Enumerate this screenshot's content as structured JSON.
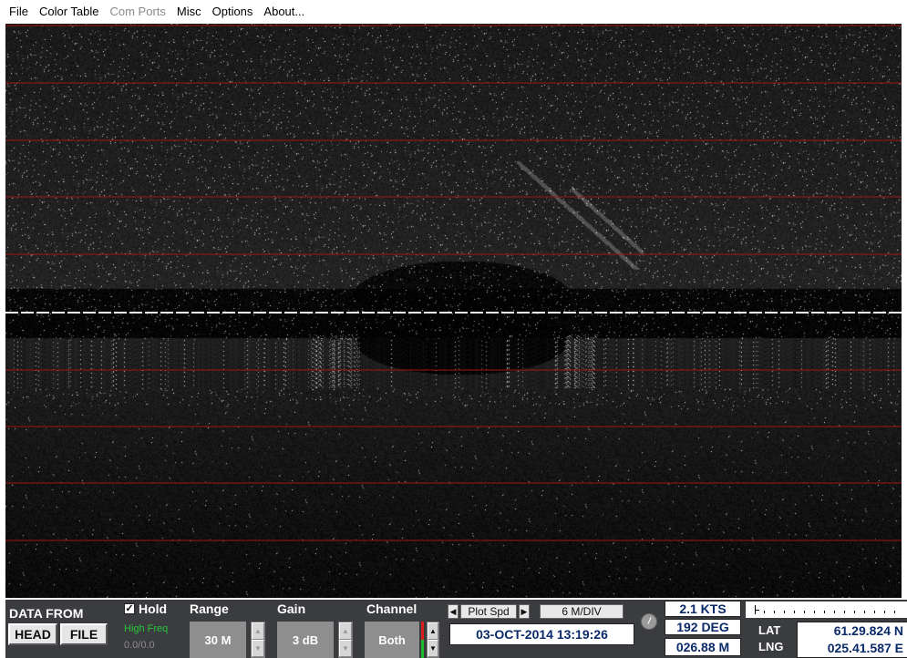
{
  "menu": {
    "items": [
      {
        "label": "File",
        "enabled": true
      },
      {
        "label": "Color Table",
        "enabled": true
      },
      {
        "label": "Com Ports",
        "enabled": false
      },
      {
        "label": "Misc",
        "enabled": true
      },
      {
        "label": "Options",
        "enabled": true
      },
      {
        "label": "About...",
        "enabled": true
      }
    ]
  },
  "display": {
    "gridline_color": "#a21414",
    "center_line_color": "#f0f0f0",
    "gridline_count": 10
  },
  "panel": {
    "data_from": {
      "label": "DATA FROM",
      "head_button": "HEAD",
      "file_button": "FILE"
    },
    "hold": {
      "label": "Hold",
      "checked": true,
      "check_mark": "✓"
    },
    "frequency": {
      "label": "High Freq",
      "value": "0.0/0.0"
    },
    "range": {
      "label": "Range",
      "value": "30 M"
    },
    "gain": {
      "label": "Gain",
      "value": "3 dB"
    },
    "channel": {
      "label": "Channel",
      "value": "Both"
    },
    "plot_speed": {
      "label": "Plot Spd",
      "value": "6 M/DIV",
      "left_arrow": "◀",
      "right_arrow": "▶"
    },
    "datetime": "03-OCT-2014  13:19:26",
    "speed": "2.1 KTS",
    "heading": "192 DEG",
    "depth": "026.88 M",
    "lat_label": "LAT",
    "lng_label": "LNG",
    "lat_value": "61.29.824 N",
    "lng_value": "025.41.587 E",
    "spinner_up": "▲",
    "spinner_down": "▼"
  }
}
